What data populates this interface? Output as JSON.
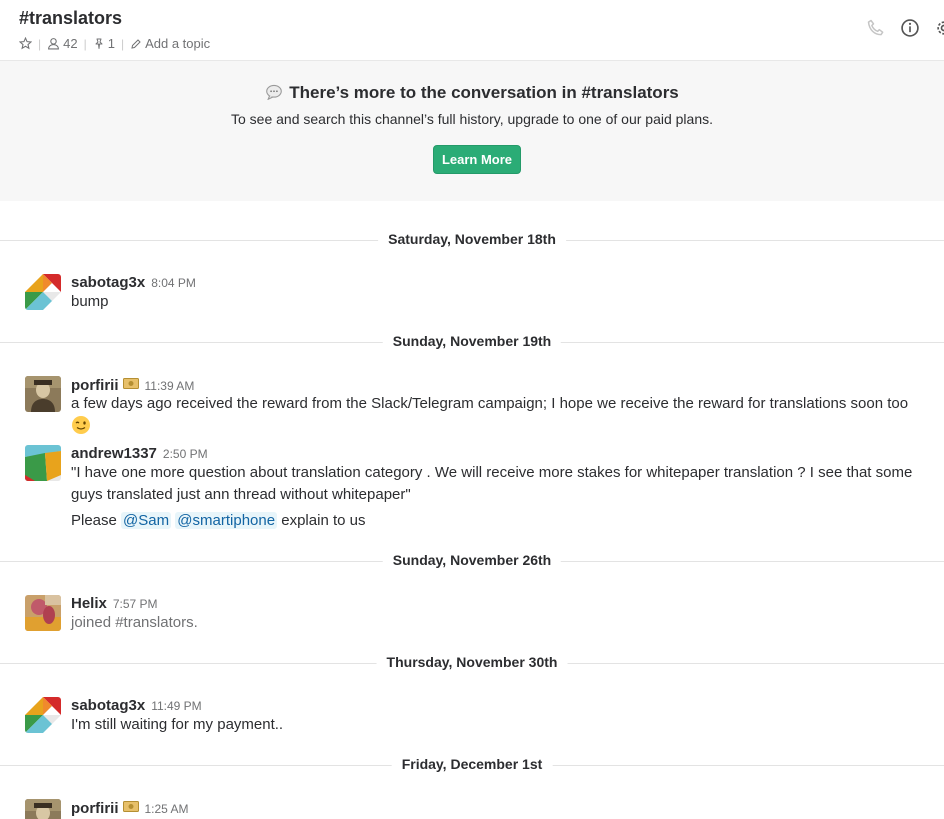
{
  "header": {
    "channel_name": "#translators",
    "member_count": "42",
    "pinned_count": "1",
    "add_topic": "Add a topic"
  },
  "banner": {
    "title": "There’s more to the conversation in #translators",
    "subtitle": "To see and search this channel’s full history, upgrade to one of our paid plans.",
    "button_label": "Learn More",
    "button_color": "#2bac76"
  },
  "dividers": [
    "Saturday, November 18th",
    "Sunday, November 19th",
    "Sunday, November 26th",
    "Thursday, November 30th",
    "Friday, December 1st"
  ],
  "messages": [
    {
      "author": "sabotag3x",
      "time": "8:04 PM",
      "text": "bump"
    },
    {
      "author": "porfirii",
      "time": "11:39 AM",
      "text": "a few days ago received the reward from the Slack/Telegram campaign; I hope we receive the reward for translations soon too",
      "emoji": "wink-emoji"
    },
    {
      "author": "andrew1337",
      "time": "2:50 PM",
      "text": "\"I have one more question about translation category . We will receive more stakes for whitepaper translation ? I see that some guys translated just ann thread without whitepaper\"",
      "followup_prefix": "Please",
      "mention1": "@Sam",
      "mention2": "@smartiphone",
      "followup_suffix": "explain to us"
    },
    {
      "author": "Helix",
      "time": "7:57 PM",
      "text": "joined #translators."
    },
    {
      "author": "sabotag3x",
      "time": "11:49 PM",
      "text": "I'm still waiting for my payment.."
    },
    {
      "author": "porfirii",
      "time": "1:25 AM",
      "text": ""
    }
  ],
  "icons": [
    "star-icon",
    "member-icon",
    "pin-icon",
    "pencil-icon",
    "phone-icon",
    "info-icon",
    "gear-icon",
    "speech-bubble-icon",
    "moneybag-badge-icon"
  ]
}
